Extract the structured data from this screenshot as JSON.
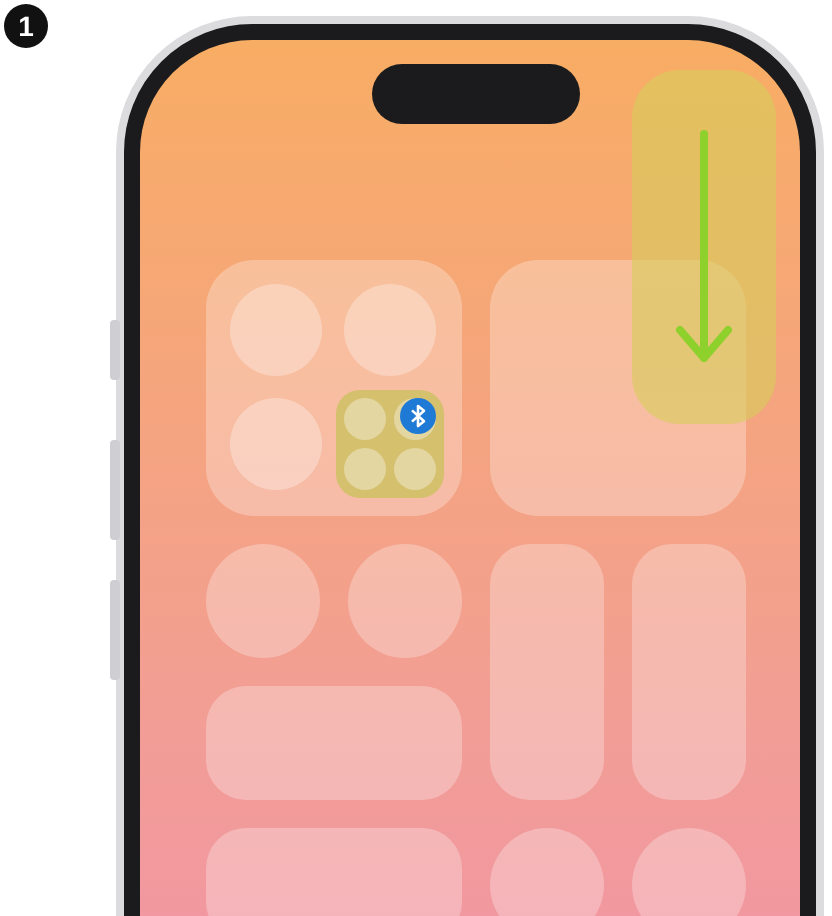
{
  "step": {
    "number": "1"
  }
}
